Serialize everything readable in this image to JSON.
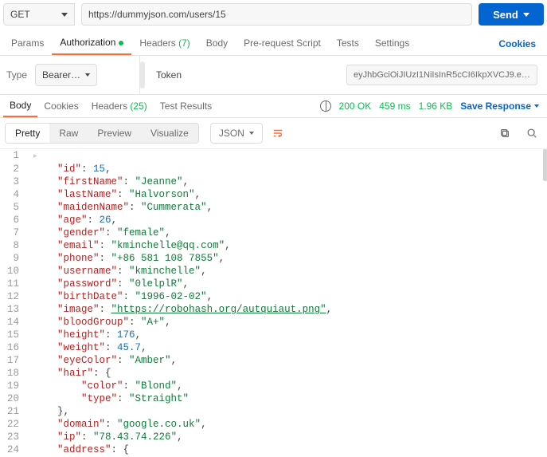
{
  "request": {
    "method": "GET",
    "url": "https://dummyjson.com/users/15",
    "send_label": "Send"
  },
  "req_tabs": {
    "params": "Params",
    "auth": "Authorization",
    "headers": "Headers",
    "headers_count": "(7)",
    "body": "Body",
    "prs": "Pre-request Script",
    "tests": "Tests",
    "settings": "Settings",
    "cookies": "Cookies"
  },
  "auth": {
    "type_label": "Type",
    "type_value": "Bearer…",
    "token_label": "Token",
    "token_value": "eyJhbGciOiJIUzI1NiIsInR5cCI6IkpXVCJ9.ey…"
  },
  "resp_tabs": {
    "body": "Body",
    "cookies": "Cookies",
    "headers": "Headers",
    "headers_count": "(25)",
    "tests": "Test Results"
  },
  "status": {
    "code": "200 OK",
    "time": "459 ms",
    "size": "1.96 KB",
    "save": "Save Response"
  },
  "view": {
    "pretty": "Pretty",
    "raw": "Raw",
    "preview": "Preview",
    "visualize": "Visualize",
    "lang": "JSON"
  },
  "json_lines": [
    [],
    [
      {
        "t": "k",
        "v": "\"id\""
      },
      {
        "t": "p",
        "v": ": "
      },
      {
        "t": "n",
        "v": "15"
      },
      {
        "t": "p",
        "v": ","
      }
    ],
    [
      {
        "t": "k",
        "v": "\"firstName\""
      },
      {
        "t": "p",
        "v": ": "
      },
      {
        "t": "s",
        "v": "\"Jeanne\""
      },
      {
        "t": "p",
        "v": ","
      }
    ],
    [
      {
        "t": "k",
        "v": "\"lastName\""
      },
      {
        "t": "p",
        "v": ": "
      },
      {
        "t": "s",
        "v": "\"Halvorson\""
      },
      {
        "t": "p",
        "v": ","
      }
    ],
    [
      {
        "t": "k",
        "v": "\"maidenName\""
      },
      {
        "t": "p",
        "v": ": "
      },
      {
        "t": "s",
        "v": "\"Cummerata\""
      },
      {
        "t": "p",
        "v": ","
      }
    ],
    [
      {
        "t": "k",
        "v": "\"age\""
      },
      {
        "t": "p",
        "v": ": "
      },
      {
        "t": "n",
        "v": "26"
      },
      {
        "t": "p",
        "v": ","
      }
    ],
    [
      {
        "t": "k",
        "v": "\"gender\""
      },
      {
        "t": "p",
        "v": ": "
      },
      {
        "t": "s",
        "v": "\"female\""
      },
      {
        "t": "p",
        "v": ","
      }
    ],
    [
      {
        "t": "k",
        "v": "\"email\""
      },
      {
        "t": "p",
        "v": ": "
      },
      {
        "t": "s",
        "v": "\"kminchelle@qq.com\""
      },
      {
        "t": "p",
        "v": ","
      }
    ],
    [
      {
        "t": "k",
        "v": "\"phone\""
      },
      {
        "t": "p",
        "v": ": "
      },
      {
        "t": "s",
        "v": "\"+86 581 108 7855\""
      },
      {
        "t": "p",
        "v": ","
      }
    ],
    [
      {
        "t": "k",
        "v": "\"username\""
      },
      {
        "t": "p",
        "v": ": "
      },
      {
        "t": "s",
        "v": "\"kminchelle\""
      },
      {
        "t": "p",
        "v": ","
      }
    ],
    [
      {
        "t": "k",
        "v": "\"password\""
      },
      {
        "t": "p",
        "v": ": "
      },
      {
        "t": "s",
        "v": "\"0lelplR\""
      },
      {
        "t": "p",
        "v": ","
      }
    ],
    [
      {
        "t": "k",
        "v": "\"birthDate\""
      },
      {
        "t": "p",
        "v": ": "
      },
      {
        "t": "s",
        "v": "\"1996-02-02\""
      },
      {
        "t": "p",
        "v": ","
      }
    ],
    [
      {
        "t": "k",
        "v": "\"image\""
      },
      {
        "t": "p",
        "v": ": "
      },
      {
        "t": "s u",
        "v": "\"https://robohash.org/autquiaut.png\""
      },
      {
        "t": "p",
        "v": ","
      }
    ],
    [
      {
        "t": "k",
        "v": "\"bloodGroup\""
      },
      {
        "t": "p",
        "v": ": "
      },
      {
        "t": "s",
        "v": "\"A+\""
      },
      {
        "t": "p",
        "v": ","
      }
    ],
    [
      {
        "t": "k",
        "v": "\"height\""
      },
      {
        "t": "p",
        "v": ": "
      },
      {
        "t": "n",
        "v": "176"
      },
      {
        "t": "p",
        "v": ","
      }
    ],
    [
      {
        "t": "k",
        "v": "\"weight\""
      },
      {
        "t": "p",
        "v": ": "
      },
      {
        "t": "n",
        "v": "45.7"
      },
      {
        "t": "p",
        "v": ","
      }
    ],
    [
      {
        "t": "k",
        "v": "\"eyeColor\""
      },
      {
        "t": "p",
        "v": ": "
      },
      {
        "t": "s",
        "v": "\"Amber\""
      },
      {
        "t": "p",
        "v": ","
      }
    ],
    [
      {
        "t": "k",
        "v": "\"hair\""
      },
      {
        "t": "p",
        "v": ": {"
      }
    ],
    [
      {
        "t": "k",
        "v": "\"color\""
      },
      {
        "t": "p",
        "v": ": "
      },
      {
        "t": "s",
        "v": "\"Blond\""
      },
      {
        "t": "p",
        "v": ","
      }
    ],
    [
      {
        "t": "k",
        "v": "\"type\""
      },
      {
        "t": "p",
        "v": ": "
      },
      {
        "t": "s",
        "v": "\"Straight\""
      }
    ],
    [
      {
        "t": "p",
        "v": "},"
      }
    ],
    [
      {
        "t": "k",
        "v": "\"domain\""
      },
      {
        "t": "p",
        "v": ": "
      },
      {
        "t": "s",
        "v": "\"google.co.uk\""
      },
      {
        "t": "p",
        "v": ","
      }
    ],
    [
      {
        "t": "k",
        "v": "\"ip\""
      },
      {
        "t": "p",
        "v": ": "
      },
      {
        "t": "s",
        "v": "\"78.43.74.226\""
      },
      {
        "t": "p",
        "v": ","
      }
    ],
    [
      {
        "t": "k",
        "v": "\"address\""
      },
      {
        "t": "p",
        "v": ": {"
      }
    ]
  ],
  "indent_map": [
    0,
    1,
    1,
    1,
    1,
    1,
    1,
    1,
    1,
    1,
    1,
    1,
    1,
    1,
    1,
    1,
    1,
    1,
    2,
    2,
    1,
    1,
    1,
    1
  ]
}
